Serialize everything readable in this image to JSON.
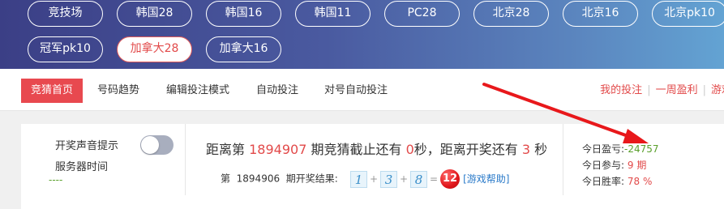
{
  "games": [
    {
      "label": "竞技场"
    },
    {
      "label": "韩国28"
    },
    {
      "label": "韩国16"
    },
    {
      "label": "韩国11"
    },
    {
      "label": "PC28"
    },
    {
      "label": "北京28"
    },
    {
      "label": "北京16"
    },
    {
      "label": "北京pk10"
    },
    {
      "label": "冠军pk10"
    },
    {
      "label": "加拿大28",
      "active": true
    },
    {
      "label": "加拿大16"
    }
  ],
  "nav": {
    "items": [
      "竞猜首页",
      "号码趋势",
      "编辑投注模式",
      "自动投注",
      "对号自动投注"
    ],
    "active_index": 0,
    "right_links": [
      "我的投注",
      "一周盈利",
      "游戏"
    ]
  },
  "settings": {
    "sound_label": "开奖声音提示",
    "sound_on": false,
    "server_time_label": "服务器时间",
    "server_time_value": "----"
  },
  "countdown": {
    "prefix": "距离第",
    "period": "1894907",
    "mid1": "期竞猜截止还有",
    "deadline_seconds": "0",
    "mid2": "秒，距离开奖还有",
    "draw_seconds": "3",
    "suffix": "秒"
  },
  "last_result": {
    "prefix": "第",
    "period": "1894906",
    "label": "期开奖结果:",
    "balls": [
      "1",
      "3",
      "8"
    ],
    "plus": "+",
    "equals": "=",
    "sum": "12",
    "help": "[游戏帮助]"
  },
  "stats": {
    "profit_label": "今日盈亏:",
    "profit_value": "-24757",
    "join_label": "今日参与:",
    "join_value": "9 期",
    "winrate_label": "今日胜率:",
    "winrate_value": "78 %"
  },
  "colors": {
    "accent": "#e8494f",
    "profit": "#5aa02c",
    "gradient_start": "#3b3f86",
    "gradient_end": "#63a3d3"
  }
}
